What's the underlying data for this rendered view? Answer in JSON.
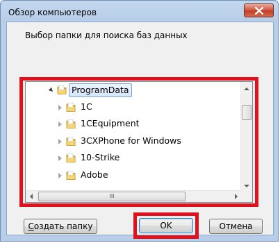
{
  "window": {
    "title": "Обзор компьютеров",
    "close_icon": "close-icon"
  },
  "description": "Выбор папки для поиска баз данных",
  "tree": {
    "items": [
      {
        "label": "ProgramData",
        "expanded": true,
        "selected": true
      },
      {
        "label": "1C",
        "expanded": false,
        "selected": false
      },
      {
        "label": "1CEquipment",
        "expanded": false,
        "selected": false
      },
      {
        "label": "3CXPhone for Windows",
        "expanded": false,
        "selected": false
      },
      {
        "label": "10-Strike",
        "expanded": false,
        "selected": false
      },
      {
        "label": "Adobe",
        "expanded": false,
        "selected": false
      }
    ],
    "hscroll_grip": "III"
  },
  "buttons": {
    "create_folder_first": "С",
    "create_folder_rest": "оздать папку",
    "ok": "OK",
    "cancel": "Отмена"
  },
  "colors": {
    "highlight": "#e0101c",
    "folder": "#f0c040"
  }
}
